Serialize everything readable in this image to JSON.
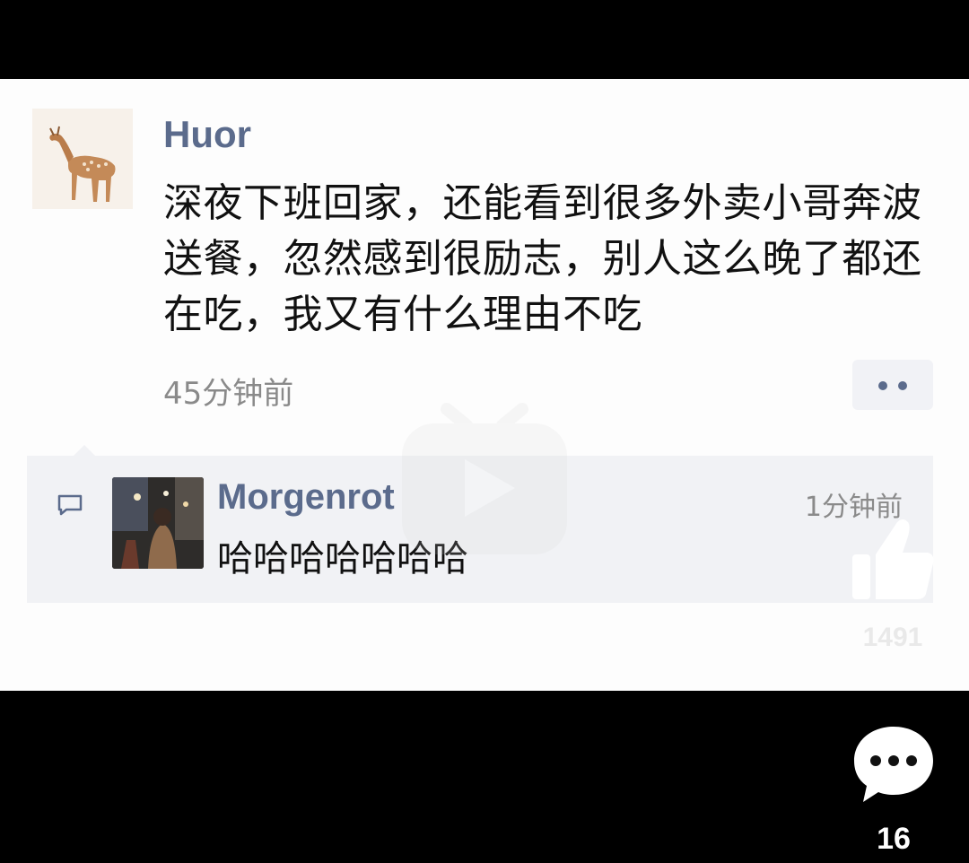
{
  "post": {
    "author": "Huor",
    "text": "深夜下班回家，还能看到很多外卖小哥奔波送餐，忽然感到很励志，别人这么晚了都还在吃，我又有什么理由不吃",
    "time": "45分钟前",
    "more_icon": "more-dots-icon"
  },
  "comment": {
    "author": "Morgenrot",
    "time": "1分钟前",
    "text": "哈哈哈哈哈哈哈",
    "icon": "comment-bubble-icon"
  },
  "overlay": {
    "likes": "1491",
    "comments": "16",
    "like_icon": "thumbs-up-icon",
    "comment_icon": "chat-dots-icon",
    "watermark_icon": "play-watermark-icon"
  },
  "colors": {
    "name_blue": "#5b6b8c",
    "card_bg": "#fdfdfd",
    "comment_bg": "#f1f2f5"
  }
}
